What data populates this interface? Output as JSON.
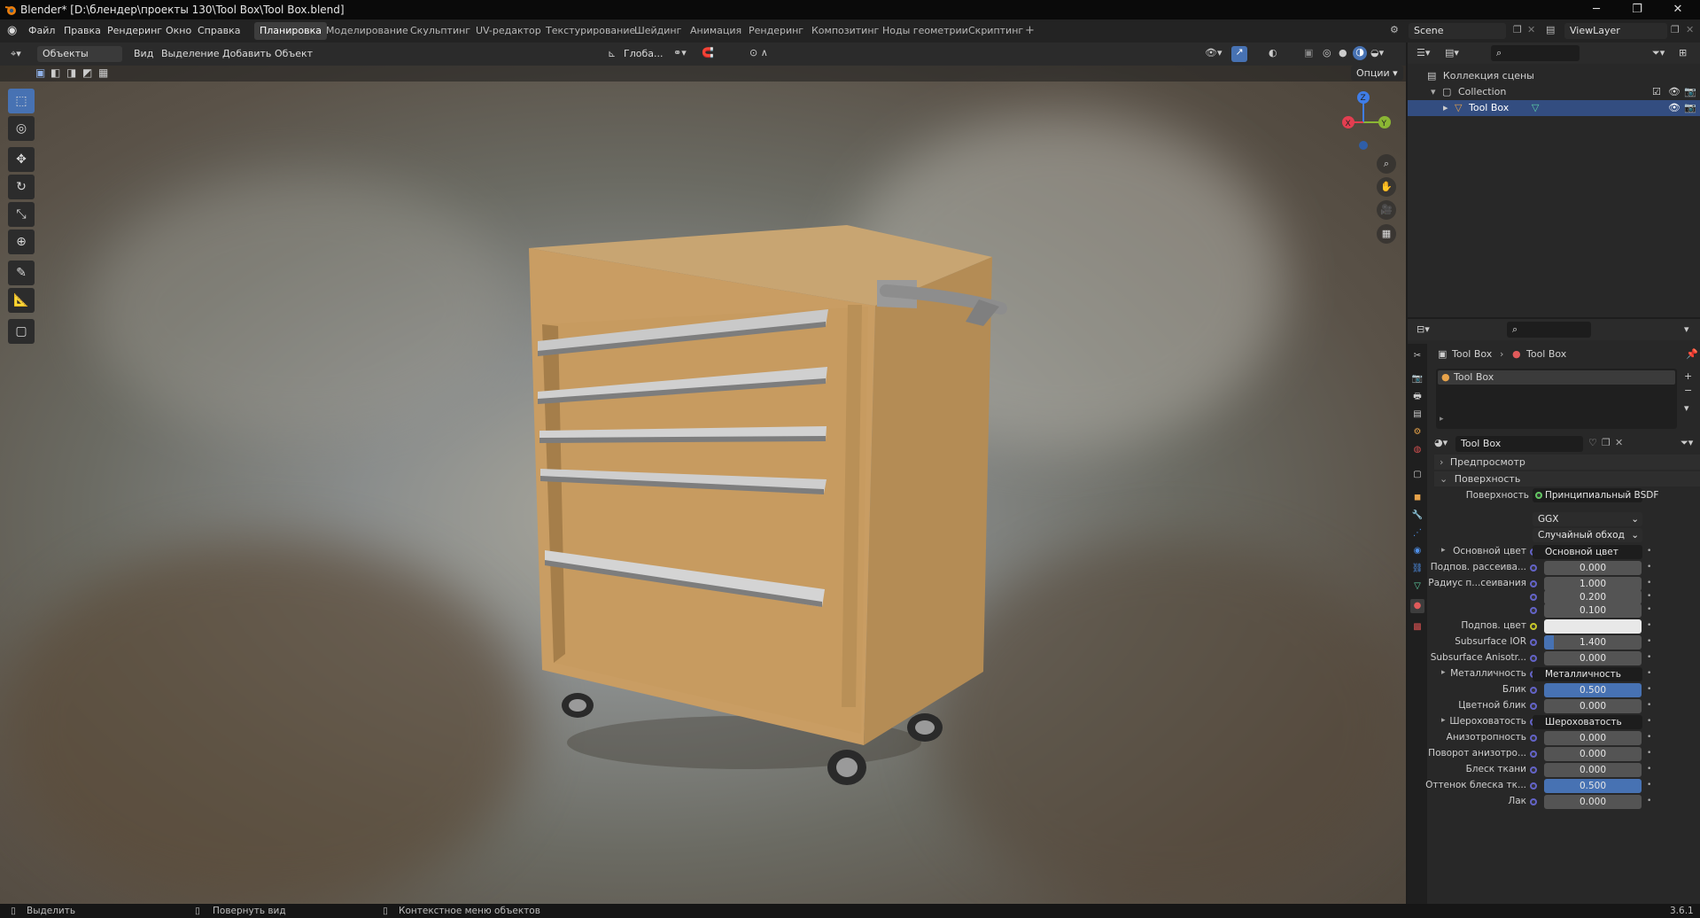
{
  "window": {
    "title": "Blender* [D:\\блендер\\проекты 130\\Tool Box\\Tool Box.blend]"
  },
  "menu": {
    "items": [
      "Файл",
      "Правка",
      "Рендеринг",
      "Окно",
      "Справка"
    ]
  },
  "workspaces": [
    "Планировка",
    "Моделирование",
    "Скульптинг",
    "UV-редактор",
    "Текстурирование",
    "Шейдинг",
    "Анимация",
    "Рендеринг",
    "Композитинг",
    "Ноды геометрии",
    "Скриптинг"
  ],
  "scene": {
    "name": "Scene",
    "view_layer": "ViewLayer"
  },
  "viewport": {
    "mode": "Объекты",
    "menus": [
      "Вид",
      "Выделение",
      "Добавить",
      "Объект"
    ],
    "orientation": "Глоба...",
    "options_label": "Опции",
    "gizmo": {
      "x": "X",
      "y": "Y",
      "z": "Z"
    }
  },
  "outliner": {
    "scene_collection": "Коллекция сцены",
    "collection": "Collection",
    "object": "Tool Box"
  },
  "properties": {
    "breadcrumb": [
      "Tool Box",
      "Tool Box"
    ],
    "slot": "Tool Box",
    "material": "Tool Box",
    "panels": {
      "preview": "Предпросмотр",
      "surface": "Поверхность"
    },
    "surface": {
      "label": "Поверхность",
      "value": "Принципиальный BSDF"
    },
    "distribution": "GGX",
    "subsurface_method": "Случайный обход",
    "rows": [
      {
        "label": "Основной цвет",
        "kind": "link",
        "value": "Основной цвет"
      },
      {
        "label": "Подпов. рассеива...",
        "kind": "num",
        "value": "0.000",
        "fill": 0
      },
      {
        "label": "Радиус п...сеивания",
        "kind": "num",
        "value": "1.000",
        "fill": 0
      },
      {
        "label": "",
        "kind": "num",
        "value": "0.200",
        "fill": 0
      },
      {
        "label": "",
        "kind": "num",
        "value": "0.100",
        "fill": 0
      },
      {
        "label": "Подпов. цвет",
        "kind": "color",
        "value": "#e8e8e8"
      },
      {
        "label": "Subsurface IOR",
        "kind": "num",
        "value": "1.400",
        "fill": 0.1
      },
      {
        "label": "Subsurface Anisotr...",
        "kind": "num",
        "value": "0.000",
        "fill": 0
      },
      {
        "label": "Металличность",
        "kind": "link",
        "value": "Металличность"
      },
      {
        "label": "Блик",
        "kind": "num",
        "value": "0.500",
        "fill": 1
      },
      {
        "label": "Цветной блик",
        "kind": "num",
        "value": "0.000",
        "fill": 0
      },
      {
        "label": "Шероховатость",
        "kind": "link",
        "value": "Шероховатость"
      },
      {
        "label": "Анизотропность",
        "kind": "num",
        "value": "0.000",
        "fill": 0
      },
      {
        "label": "Поворот анизотро...",
        "kind": "num",
        "value": "0.000",
        "fill": 0
      },
      {
        "label": "Блеск ткани",
        "kind": "num",
        "value": "0.000",
        "fill": 0
      },
      {
        "label": "Оттенок блеска тк...",
        "kind": "num",
        "value": "0.500",
        "fill": 1
      },
      {
        "label": "Лак",
        "kind": "num",
        "value": "0.000",
        "fill": 0
      }
    ]
  },
  "status": {
    "select": "Выделить",
    "rotate": "Повернуть вид",
    "context": "Контекстное меню объектов",
    "version": "3.6.1"
  }
}
